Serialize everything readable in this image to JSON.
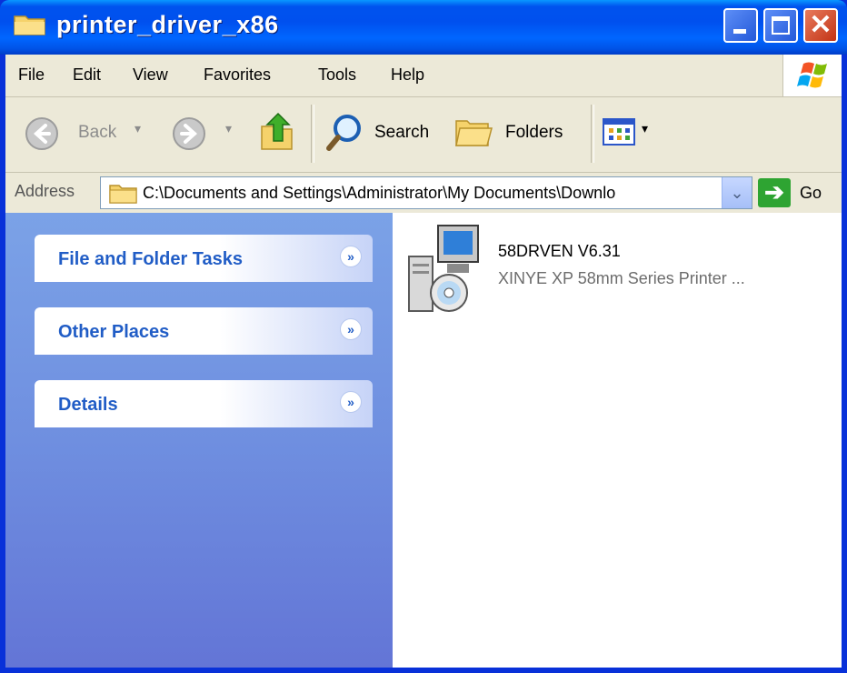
{
  "window": {
    "title": "printer_driver_x86"
  },
  "menu": {
    "items": [
      "File",
      "Edit",
      "View",
      "Favorites",
      "Tools",
      "Help"
    ]
  },
  "toolbar": {
    "back_label": "Back",
    "search_label": "Search",
    "folders_label": "Folders"
  },
  "address": {
    "label": "Address",
    "path": "C:\\Documents and Settings\\Administrator\\My Documents\\Downlo",
    "go_label": "Go"
  },
  "tasks": {
    "panels": [
      {
        "title": "File and Folder Tasks"
      },
      {
        "title": "Other Places"
      },
      {
        "title": "Details"
      }
    ]
  },
  "files": [
    {
      "name": "58DRVEN V6.31",
      "description": "XINYE XP 58mm Series Printer ...",
      "icon": "installer-icon"
    }
  ],
  "colors": {
    "titlebar": "#0053ee",
    "taskpane_link": "#215dc6",
    "go_green": "#2ea432"
  }
}
